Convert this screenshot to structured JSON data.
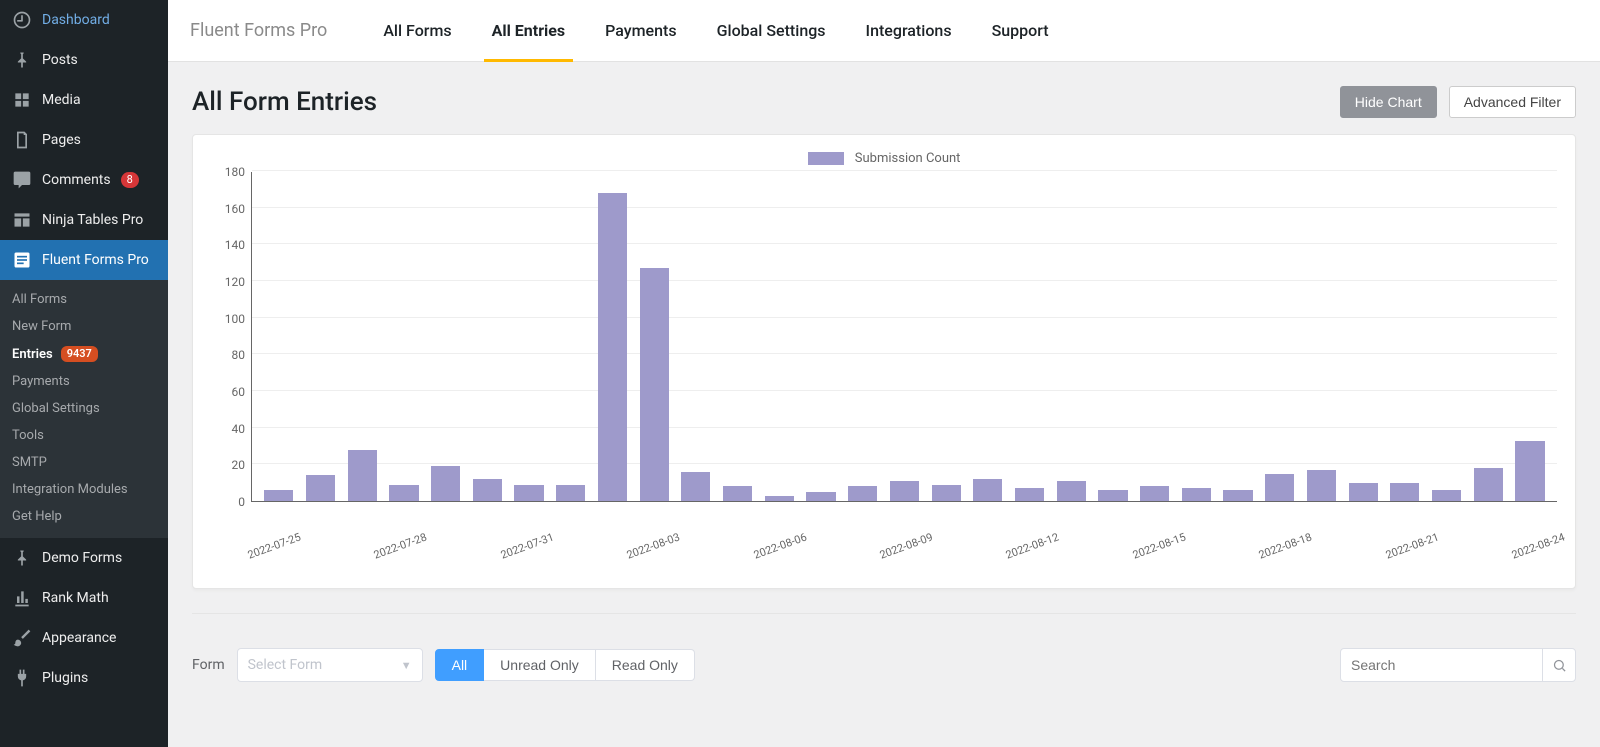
{
  "sidebar": {
    "items": [
      {
        "label": "Dashboard",
        "icon": "dashboard"
      },
      {
        "label": "Posts",
        "icon": "pin"
      },
      {
        "label": "Media",
        "icon": "media"
      },
      {
        "label": "Pages",
        "icon": "page"
      },
      {
        "label": "Comments",
        "icon": "comment",
        "badge": "8"
      },
      {
        "label": "Ninja Tables Pro",
        "icon": "table"
      },
      {
        "label": "Fluent Forms Pro",
        "icon": "form",
        "active": true
      },
      {
        "label": "Demo Forms",
        "icon": "pin"
      },
      {
        "label": "Rank Math",
        "icon": "chart"
      },
      {
        "label": "Appearance",
        "icon": "brush"
      },
      {
        "label": "Plugins",
        "icon": "plug"
      }
    ],
    "sub_items": [
      {
        "label": "All Forms"
      },
      {
        "label": "New Form"
      },
      {
        "label": "Entries",
        "current": true,
        "badge": "9437"
      },
      {
        "label": "Payments"
      },
      {
        "label": "Global Settings"
      },
      {
        "label": "Tools"
      },
      {
        "label": "SMTP"
      },
      {
        "label": "Integration Modules"
      },
      {
        "label": "Get Help"
      }
    ]
  },
  "app_nav": {
    "brand": "Fluent Forms Pro",
    "tabs": [
      {
        "label": "All Forms"
      },
      {
        "label": "All Entries",
        "active": true
      },
      {
        "label": "Payments"
      },
      {
        "label": "Global Settings"
      },
      {
        "label": "Integrations"
      },
      {
        "label": "Support"
      }
    ]
  },
  "page": {
    "title": "All Form Entries",
    "hide_chart": "Hide Chart",
    "advanced_filter": "Advanced Filter"
  },
  "chart_data": {
    "type": "bar",
    "title": "Submission Count",
    "ylabel": "",
    "xlabel": "",
    "ylim": [
      0,
      180
    ],
    "yticks": [
      0,
      20,
      40,
      60,
      80,
      100,
      120,
      140,
      160,
      180
    ],
    "categories": [
      "2022-07-25",
      "2022-07-26",
      "2022-07-27",
      "2022-07-28",
      "2022-07-29",
      "2022-07-30",
      "2022-07-31",
      "2022-08-01",
      "2022-08-02",
      "2022-08-03",
      "2022-08-04",
      "2022-08-05",
      "2022-08-06",
      "2022-08-07",
      "2022-08-08",
      "2022-08-09",
      "2022-08-10",
      "2022-08-11",
      "2022-08-12",
      "2022-08-13",
      "2022-08-14",
      "2022-08-15",
      "2022-08-16",
      "2022-08-17",
      "2022-08-18",
      "2022-08-19",
      "2022-08-20",
      "2022-08-21",
      "2022-08-22",
      "2022-08-23",
      "2022-08-24"
    ],
    "values": [
      6,
      14,
      28,
      9,
      19,
      12,
      9,
      9,
      168,
      127,
      16,
      8,
      3,
      5,
      8,
      11,
      9,
      12,
      7,
      11,
      6,
      8,
      7,
      6,
      15,
      17,
      10,
      10,
      6,
      18,
      33
    ],
    "xlabel_indices": [
      0,
      3,
      6,
      9,
      12,
      15,
      18,
      21,
      24,
      27,
      30
    ]
  },
  "filters": {
    "form_label": "Form",
    "select_placeholder": "Select Form",
    "buttons": [
      {
        "label": "All",
        "active": true
      },
      {
        "label": "Unread Only"
      },
      {
        "label": "Read Only"
      }
    ],
    "search_placeholder": "Search"
  }
}
